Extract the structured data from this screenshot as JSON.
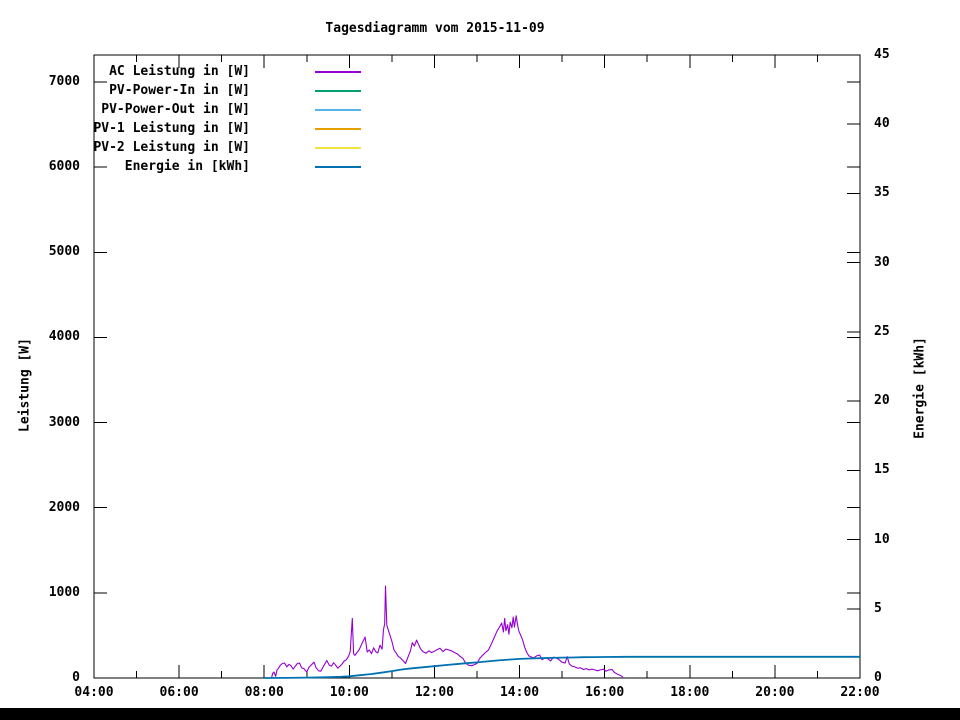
{
  "footer_bar": {
    "color": "#000000"
  },
  "chart_data": {
    "type": "line",
    "title": "Tagesdiagramm vom 2015-11-09",
    "grid": false,
    "legend_position": "top-left-inside",
    "x": {
      "min": 4,
      "max": 22,
      "major_ticks": [
        4,
        6,
        8,
        10,
        12,
        14,
        16,
        18,
        20,
        22
      ],
      "minor_ticks": [
        5,
        7,
        9,
        11,
        13,
        15,
        17,
        19,
        21
      ],
      "tick_labels": [
        "04:00",
        "06:00",
        "08:00",
        "10:00",
        "12:00",
        "14:00",
        "16:00",
        "18:00",
        "20:00",
        "22:00"
      ]
    },
    "y_left": {
      "label": "Leistung [W]",
      "min": 0,
      "max": 7317,
      "ticks": [
        0,
        1000,
        2000,
        3000,
        4000,
        5000,
        6000,
        7000
      ],
      "tick_labels": [
        "0",
        "1000",
        "2000",
        "3000",
        "4000",
        "5000",
        "6000",
        "7000"
      ]
    },
    "y_right": {
      "label": "Energie [kWh]",
      "min": 0,
      "max": 45,
      "ticks": [
        0,
        5,
        10,
        15,
        20,
        25,
        30,
        35,
        40,
        45
      ],
      "tick_labels": [
        "0",
        "5",
        "10",
        "15",
        "20",
        "25",
        "30",
        "35",
        "40",
        "45"
      ]
    },
    "series": [
      {
        "name": "AC Leistung in [W]",
        "color": "#9400d3",
        "axis": "left",
        "stroke_width": 1.1,
        "points": [
          [
            8.17,
            0
          ],
          [
            8.2,
            55
          ],
          [
            8.23,
            70
          ],
          [
            8.27,
            20
          ],
          [
            8.3,
            95
          ],
          [
            8.33,
            110
          ],
          [
            8.38,
            150
          ],
          [
            8.43,
            170
          ],
          [
            8.48,
            175
          ],
          [
            8.53,
            130
          ],
          [
            8.58,
            160
          ],
          [
            8.63,
            145
          ],
          [
            8.68,
            105
          ],
          [
            8.73,
            140
          ],
          [
            8.78,
            170
          ],
          [
            8.83,
            175
          ],
          [
            8.88,
            120
          ],
          [
            8.93,
            110
          ],
          [
            9.0,
            70
          ],
          [
            9.05,
            125
          ],
          [
            9.1,
            150
          ],
          [
            9.17,
            185
          ],
          [
            9.22,
            120
          ],
          [
            9.28,
            85
          ],
          [
            9.33,
            80
          ],
          [
            9.4,
            145
          ],
          [
            9.47,
            205
          ],
          [
            9.53,
            150
          ],
          [
            9.58,
            140
          ],
          [
            9.63,
            180
          ],
          [
            9.68,
            150
          ],
          [
            9.73,
            115
          ],
          [
            9.78,
            140
          ],
          [
            9.83,
            165
          ],
          [
            9.88,
            200
          ],
          [
            9.93,
            215
          ],
          [
            9.98,
            255
          ],
          [
            10.02,
            310
          ],
          [
            10.07,
            700
          ],
          [
            10.1,
            285
          ],
          [
            10.13,
            265
          ],
          [
            10.18,
            300
          ],
          [
            10.23,
            330
          ],
          [
            10.28,
            385
          ],
          [
            10.33,
            440
          ],
          [
            10.37,
            480
          ],
          [
            10.42,
            305
          ],
          [
            10.47,
            330
          ],
          [
            10.52,
            285
          ],
          [
            10.57,
            355
          ],
          [
            10.62,
            310
          ],
          [
            10.67,
            295
          ],
          [
            10.72,
            385
          ],
          [
            10.77,
            340
          ],
          [
            10.8,
            560
          ],
          [
            10.83,
            640
          ],
          [
            10.85,
            1080
          ],
          [
            10.88,
            620
          ],
          [
            10.92,
            555
          ],
          [
            10.97,
            480
          ],
          [
            11.0,
            430
          ],
          [
            11.05,
            330
          ],
          [
            11.1,
            295
          ],
          [
            11.15,
            255
          ],
          [
            11.2,
            235
          ],
          [
            11.27,
            200
          ],
          [
            11.32,
            170
          ],
          [
            11.38,
            250
          ],
          [
            11.43,
            310
          ],
          [
            11.48,
            415
          ],
          [
            11.53,
            375
          ],
          [
            11.58,
            445
          ],
          [
            11.63,
            390
          ],
          [
            11.68,
            340
          ],
          [
            11.73,
            310
          ],
          [
            11.8,
            290
          ],
          [
            11.87,
            320
          ],
          [
            11.93,
            300
          ],
          [
            12.0,
            315
          ],
          [
            12.07,
            335
          ],
          [
            12.13,
            350
          ],
          [
            12.2,
            310
          ],
          [
            12.27,
            340
          ],
          [
            12.33,
            330
          ],
          [
            12.4,
            320
          ],
          [
            12.47,
            300
          ],
          [
            12.53,
            285
          ],
          [
            12.6,
            255
          ],
          [
            12.67,
            230
          ],
          [
            12.73,
            175
          ],
          [
            12.8,
            150
          ],
          [
            12.87,
            145
          ],
          [
            12.93,
            155
          ],
          [
            13.0,
            170
          ],
          [
            13.07,
            235
          ],
          [
            13.13,
            265
          ],
          [
            13.2,
            300
          ],
          [
            13.27,
            330
          ],
          [
            13.33,
            390
          ],
          [
            13.4,
            470
          ],
          [
            13.47,
            550
          ],
          [
            13.53,
            600
          ],
          [
            13.58,
            645
          ],
          [
            13.62,
            540
          ],
          [
            13.65,
            700
          ],
          [
            13.68,
            555
          ],
          [
            13.72,
            625
          ],
          [
            13.75,
            515
          ],
          [
            13.78,
            655
          ],
          [
            13.82,
            590
          ],
          [
            13.85,
            715
          ],
          [
            13.88,
            600
          ],
          [
            13.92,
            730
          ],
          [
            13.95,
            635
          ],
          [
            13.98,
            555
          ],
          [
            14.02,
            510
          ],
          [
            14.07,
            450
          ],
          [
            14.12,
            360
          ],
          [
            14.17,
            300
          ],
          [
            14.22,
            260
          ],
          [
            14.28,
            245
          ],
          [
            14.33,
            235
          ],
          [
            14.4,
            260
          ],
          [
            14.47,
            270
          ],
          [
            14.53,
            215
          ],
          [
            14.6,
            235
          ],
          [
            14.67,
            225
          ],
          [
            14.73,
            200
          ],
          [
            14.8,
            245
          ],
          [
            14.87,
            235
          ],
          [
            14.93,
            215
          ],
          [
            15.0,
            185
          ],
          [
            15.07,
            175
          ],
          [
            15.12,
            250
          ],
          [
            15.17,
            165
          ],
          [
            15.23,
            140
          ],
          [
            15.3,
            130
          ],
          [
            15.37,
            115
          ],
          [
            15.43,
            120
          ],
          [
            15.5,
            100
          ],
          [
            15.57,
            110
          ],
          [
            15.63,
            95
          ],
          [
            15.7,
            105
          ],
          [
            15.77,
            95
          ],
          [
            15.83,
            85
          ],
          [
            15.9,
            95
          ],
          [
            15.97,
            105
          ],
          [
            16.03,
            80
          ],
          [
            16.1,
            95
          ],
          [
            16.17,
            100
          ],
          [
            16.23,
            65
          ],
          [
            16.3,
            45
          ],
          [
            16.37,
            30
          ],
          [
            16.43,
            10
          ]
        ]
      },
      {
        "name": "PV-Power-In in [W]",
        "color": "#009e73",
        "axis": "left",
        "stroke_width": 1.1,
        "points": []
      },
      {
        "name": "PV-Power-Out in [W]",
        "color": "#56b4e9",
        "axis": "left",
        "stroke_width": 1.1,
        "points": []
      },
      {
        "name": "PV-1 Leistung in [W]",
        "color": "#e69f00",
        "axis": "left",
        "stroke_width": 1.1,
        "points": []
      },
      {
        "name": "PV-2 Leistung in [W]",
        "color": "#f0e442",
        "axis": "left",
        "stroke_width": 1.1,
        "points": []
      },
      {
        "name": "Energie in [kWh]",
        "color": "#0072b2",
        "axis": "right",
        "stroke_width": 1.8,
        "points": [
          [
            8.0,
            0
          ],
          [
            8.5,
            0.01
          ],
          [
            9.0,
            0.03
          ],
          [
            9.5,
            0.06
          ],
          [
            9.8,
            0.09
          ],
          [
            10.0,
            0.12
          ],
          [
            10.25,
            0.2
          ],
          [
            10.5,
            0.28
          ],
          [
            10.75,
            0.38
          ],
          [
            11.0,
            0.5
          ],
          [
            11.25,
            0.62
          ],
          [
            11.5,
            0.71
          ],
          [
            11.75,
            0.78
          ],
          [
            12.0,
            0.85
          ],
          [
            12.25,
            0.93
          ],
          [
            12.5,
            1.0
          ],
          [
            12.75,
            1.07
          ],
          [
            13.0,
            1.13
          ],
          [
            13.25,
            1.2
          ],
          [
            13.5,
            1.27
          ],
          [
            13.75,
            1.33
          ],
          [
            14.0,
            1.38
          ],
          [
            14.25,
            1.41
          ],
          [
            14.5,
            1.43
          ],
          [
            14.75,
            1.45
          ],
          [
            15.0,
            1.47
          ],
          [
            15.25,
            1.48
          ],
          [
            15.5,
            1.5
          ],
          [
            15.75,
            1.51
          ],
          [
            16.0,
            1.52
          ],
          [
            16.5,
            1.53
          ],
          [
            17.0,
            1.53
          ],
          [
            18.0,
            1.53
          ],
          [
            19.0,
            1.53
          ],
          [
            20.0,
            1.53
          ],
          [
            21.0,
            1.53
          ],
          [
            22.0,
            1.53
          ]
        ]
      }
    ]
  }
}
